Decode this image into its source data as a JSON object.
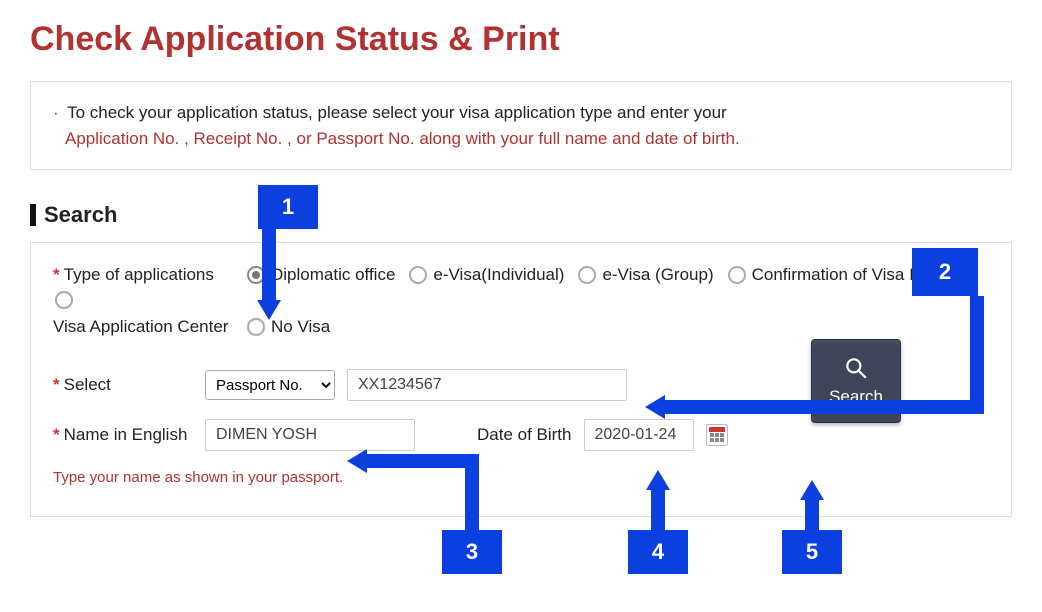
{
  "title": "Check Application Status & Print",
  "info": {
    "line1_pre": "To check your application status, please select your visa application type and enter your",
    "line2": "Application No. , Receipt No. , or Passport No. along with your full name and date of birth."
  },
  "section_header": "Search",
  "type_label": "Type of applications",
  "vac_label": "Visa Application Center",
  "radios": {
    "diplomatic": "Diplomatic office",
    "evisa_individual": "e-Visa(Individual)",
    "evisa_group": "e-Visa (Group)",
    "confirmation": "Confirmation of Visa Issuance",
    "no_visa": "No Visa"
  },
  "select_label": "Select",
  "select_value": "Passport No.",
  "ident_value": "XX1234567",
  "name_label": "Name in English",
  "name_value": "DIMEN YOSH",
  "dob_label": "Date of Birth",
  "dob_value": "2020-01-24",
  "hint": "Type your name as shown in your passport.",
  "search_btn": "Search",
  "callouts": {
    "c1": "1",
    "c2": "2",
    "c3": "3",
    "c4": "4",
    "c5": "5"
  }
}
